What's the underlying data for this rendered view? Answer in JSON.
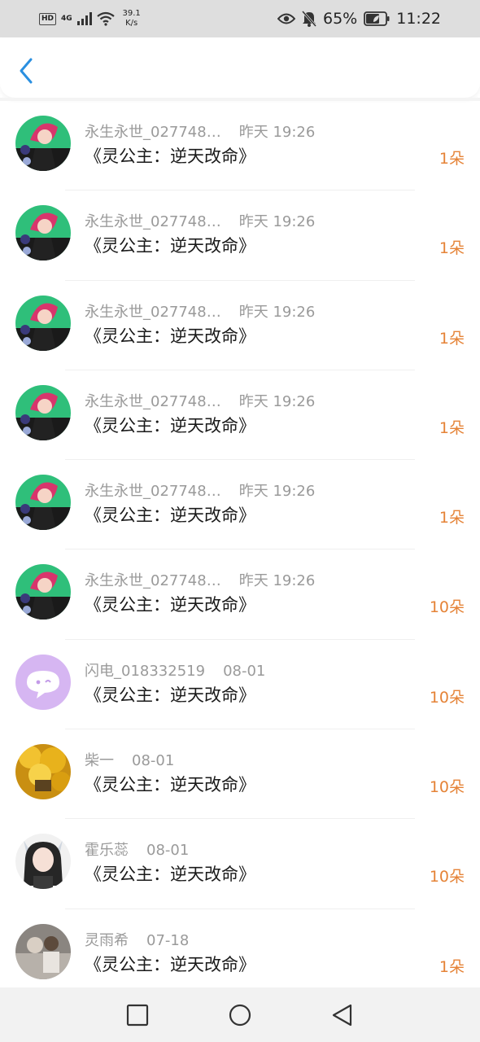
{
  "status_bar": {
    "hd": "HD",
    "network": "4G",
    "speed_value": "39.1",
    "speed_unit": "K/s",
    "battery": "65%",
    "time": "11:22"
  },
  "header": {
    "back_icon": "chevron-left-icon",
    "accent": "#2a8fe0"
  },
  "items": [
    {
      "name": "永生永世_027748…",
      "time": "昨天 19:26",
      "title": "《灵公主：逆天改命》",
      "count": "1朵",
      "avatar": "anime-girl"
    },
    {
      "name": "永生永世_027748…",
      "time": "昨天 19:26",
      "title": "《灵公主：逆天改命》",
      "count": "1朵",
      "avatar": "anime-girl"
    },
    {
      "name": "永生永世_027748…",
      "time": "昨天 19:26",
      "title": "《灵公主：逆天改命》",
      "count": "1朵",
      "avatar": "anime-girl"
    },
    {
      "name": "永生永世_027748…",
      "time": "昨天 19:26",
      "title": "《灵公主：逆天改命》",
      "count": "1朵",
      "avatar": "anime-girl"
    },
    {
      "name": "永生永世_027748…",
      "time": "昨天 19:26",
      "title": "《灵公主：逆天改命》",
      "count": "1朵",
      "avatar": "anime-girl"
    },
    {
      "name": "永生永世_027748…",
      "time": "昨天 19:26",
      "title": "《灵公主：逆天改命》",
      "count": "10朵",
      "avatar": "anime-girl"
    },
    {
      "name": "闪电_018332519",
      "time": "08-01",
      "title": "《灵公主：逆天改命》",
      "count": "10朵",
      "avatar": "chat-bubble"
    },
    {
      "name": "柴一",
      "time": "08-01",
      "title": "《灵公主：逆天改命》",
      "count": "10朵",
      "avatar": "golden-leaves"
    },
    {
      "name": "霍乐蕊",
      "time": "08-01",
      "title": "《灵公主：逆天改命》",
      "count": "10朵",
      "avatar": "girl-portrait"
    },
    {
      "name": "灵雨希",
      "time": "07-18",
      "title": "《灵公主：逆天改命》",
      "count": "1朵",
      "avatar": "grey-photo"
    }
  ],
  "colors": {
    "count": "#e58337",
    "meta": "#9a9a9a",
    "title": "#1a1a1a"
  },
  "nav_bar": {
    "recent_icon": "square-icon",
    "home_icon": "circle-icon",
    "back_icon": "triangle-back-icon"
  }
}
